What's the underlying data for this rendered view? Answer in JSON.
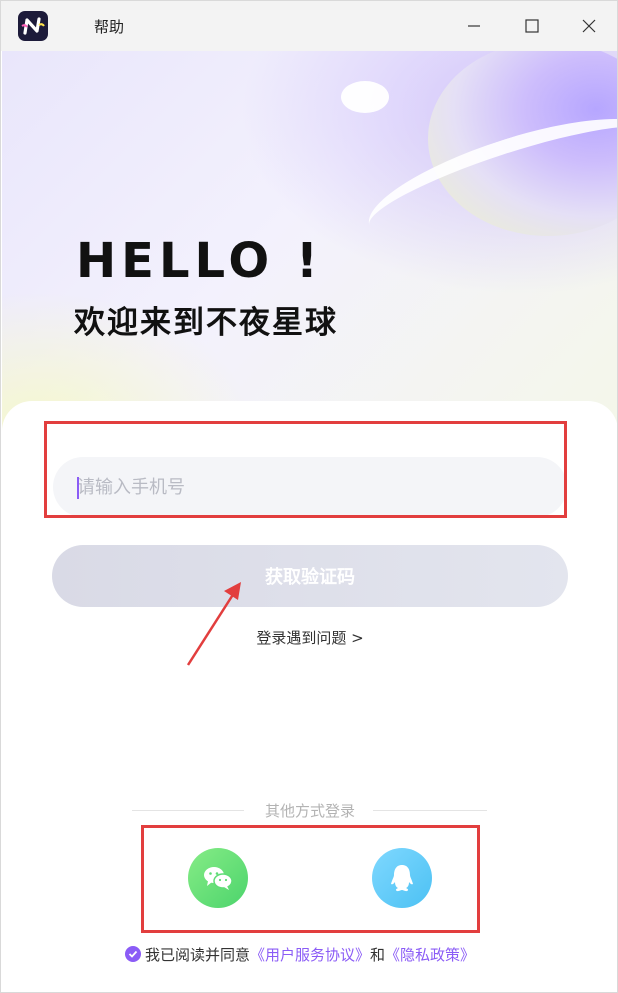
{
  "window": {
    "title": "帮助",
    "icons": {
      "app": "app-logo-icon",
      "minimize": "minimize-icon",
      "maximize": "maximize-icon",
      "close": "close-icon"
    }
  },
  "hero": {
    "hello": "HELLO !",
    "welcome": "欢迎来到不夜星球"
  },
  "login": {
    "phone_placeholder": "请输入手机号",
    "code_button": "获取验证码",
    "help_link": "登录遇到问题 >"
  },
  "social": {
    "label": "其他方式登录",
    "providers": [
      {
        "name": "wechat",
        "icon": "wechat-icon",
        "color": "#4cd46c"
      },
      {
        "name": "qq",
        "icon": "qq-icon",
        "color": "#4cc1f3"
      }
    ]
  },
  "agreement": {
    "prefix": "我已阅读并同意",
    "user_agreement": "《用户服务协议》",
    "and": "和",
    "privacy_policy": "《隐私政策》"
  },
  "colors": {
    "accent": "#8b5cf6",
    "highlight_box": "#e23e3e",
    "button_disabled": "#dcdde8"
  }
}
